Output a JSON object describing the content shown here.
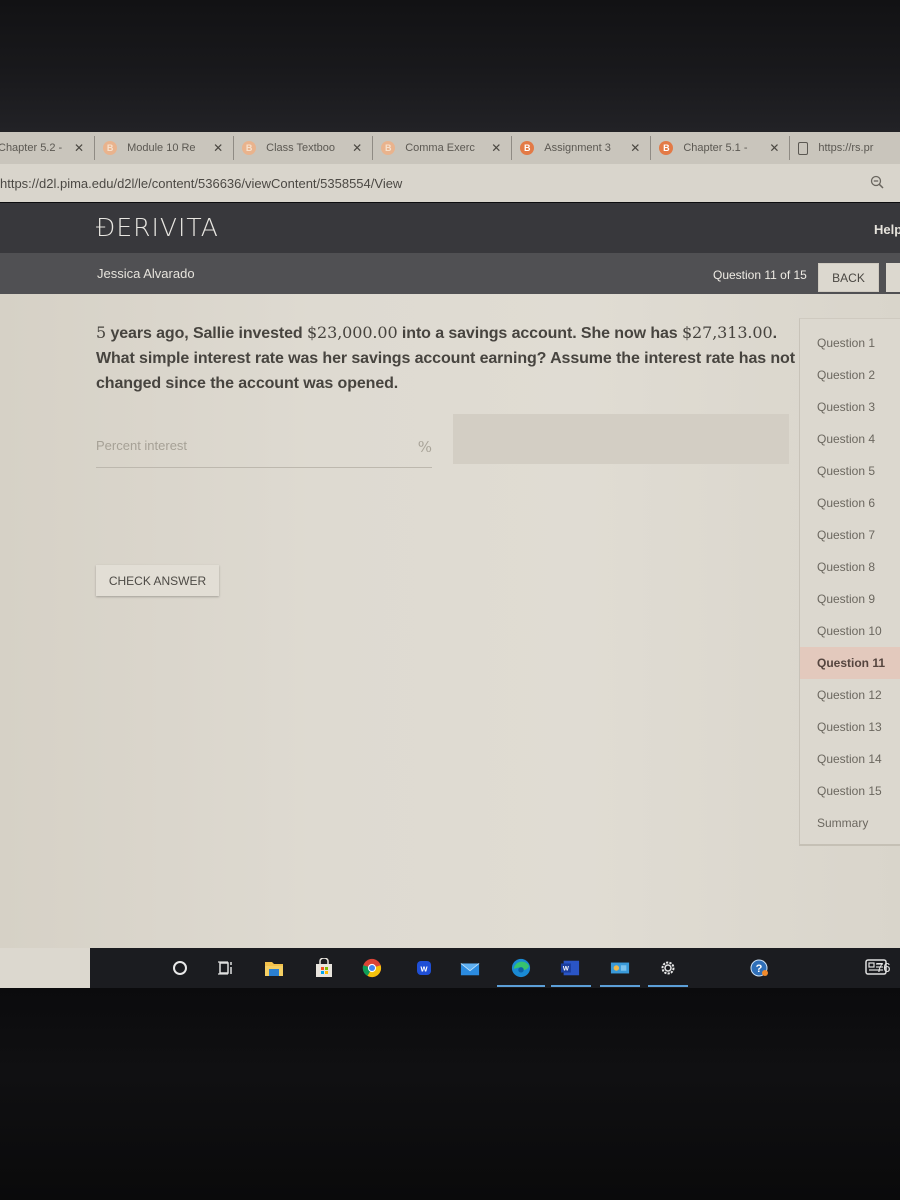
{
  "browser": {
    "tabs": [
      {
        "label": "Chapter 5.2 -",
        "favicon": "none",
        "close": "✕"
      },
      {
        "label": "Module 10 Re",
        "favicon": "B",
        "close": "✕"
      },
      {
        "label": "Class Textboo",
        "favicon": "B",
        "close": "✕"
      },
      {
        "label": "Comma Exerc",
        "favicon": "B",
        "close": "✕"
      },
      {
        "label": "Assignment 3",
        "favicon": "B",
        "close": "✕"
      },
      {
        "label": "Chapter 5.1 -",
        "favicon": "B",
        "close": "✕"
      },
      {
        "label": "https://rs.pr",
        "favicon": "page-icon"
      }
    ],
    "url": "https://d2l.pima.edu/d2l/le/content/536636/viewContent/5358554/View",
    "favicon_color": "#e37a46"
  },
  "app": {
    "logo": "ĐERIVITA",
    "help_label": "Help",
    "student_name": "Jessica Alvarado",
    "question_counter": "Question 11 of 15",
    "back_label": "BACK"
  },
  "question": {
    "parts": [
      {
        "text": "5",
        "math": true
      },
      {
        "text": " years ago, Sallie invested ",
        "math": false
      },
      {
        "text": "$23,000.00",
        "math": true
      },
      {
        "text": " into a savings account.  She now has ",
        "math": false
      },
      {
        "text": "$27,313.00",
        "math": true
      },
      {
        "text": ".  What simple interest rate was her savings account earning?  Assume the interest rate has not changed since the account was opened.",
        "math": false
      }
    ],
    "answer_placeholder": "Percent interest",
    "answer_value": "",
    "answer_suffix": "%",
    "check_answer_label": "CHECK ANSWER"
  },
  "question_nav": {
    "items": [
      {
        "label": "Question 1",
        "active": false
      },
      {
        "label": "Question 2",
        "active": false
      },
      {
        "label": "Question 3",
        "active": false
      },
      {
        "label": "Question 4",
        "active": false
      },
      {
        "label": "Question 5",
        "active": false
      },
      {
        "label": "Question 6",
        "active": false
      },
      {
        "label": "Question 7",
        "active": false
      },
      {
        "label": "Question 8",
        "active": false
      },
      {
        "label": "Question 9",
        "active": false
      },
      {
        "label": "Question 10",
        "active": false
      },
      {
        "label": "Question 11",
        "active": true
      },
      {
        "label": "Question 12",
        "active": false
      },
      {
        "label": "Question 13",
        "active": false
      },
      {
        "label": "Question 14",
        "active": false
      },
      {
        "label": "Question 15",
        "active": false
      },
      {
        "label": "Summary",
        "active": false
      }
    ],
    "active_color": "#e3c9bd"
  },
  "taskbar": {
    "icons": [
      "search-icon",
      "task-view-icon",
      "file-explorer-icon",
      "store-icon",
      "chrome-icon",
      "w-app-icon",
      "mail-icon",
      "edge-icon",
      "word-icon",
      "photos-icon",
      "settings-icon",
      "help-icon",
      "news-icon"
    ],
    "weather_temp": "76",
    "accent_color": "#5c9fd8"
  }
}
